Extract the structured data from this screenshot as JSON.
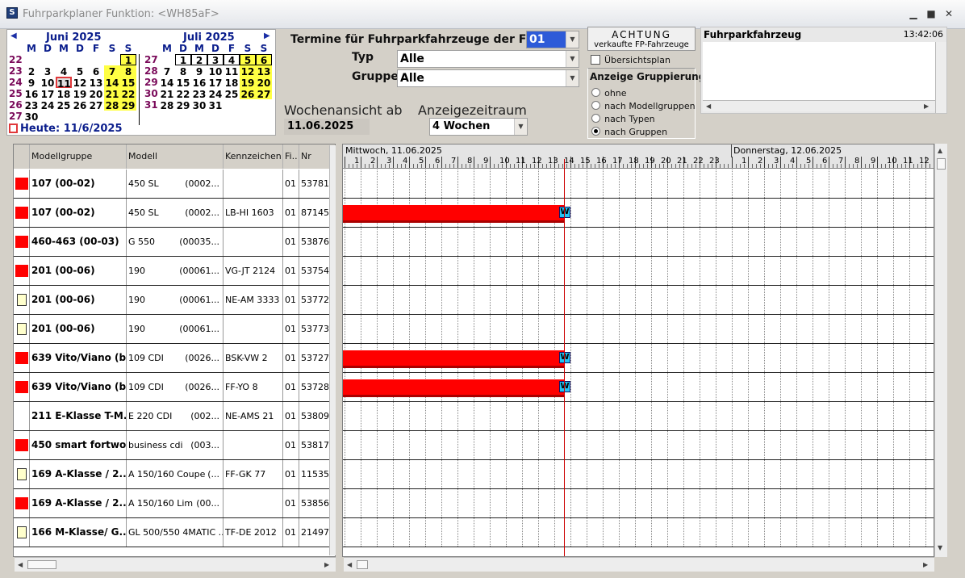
{
  "window": {
    "title": "Fuhrparkplaner Funktion: <WH85aF>",
    "min": "▁",
    "max": "■",
    "close": "✕"
  },
  "calendar": {
    "month1": "Juni 2025",
    "month2": "Juli 2025",
    "dow": [
      "M",
      "D",
      "M",
      "D",
      "F",
      "S",
      "S"
    ],
    "weeks1": [
      "22",
      "23",
      "24",
      "25",
      "26",
      "27"
    ],
    "weeks2": [
      "27",
      "28",
      "29",
      "30",
      "31"
    ],
    "days1": [
      [
        "",
        "",
        "",
        "",
        "",
        "",
        "1"
      ],
      [
        "2",
        "3",
        "4",
        "5",
        "6",
        "7",
        "8"
      ],
      [
        "9",
        "10",
        "11",
        "12",
        "13",
        "14",
        "15"
      ],
      [
        "16",
        "17",
        "18",
        "19",
        "20",
        "21",
        "22"
      ],
      [
        "23",
        "24",
        "25",
        "26",
        "27",
        "28",
        "29"
      ],
      [
        "30",
        "",
        "",
        "",
        "",
        "",
        ""
      ]
    ],
    "days2": [
      [
        "",
        "1",
        "2",
        "3",
        "4",
        "5",
        "6"
      ],
      [
        "7",
        "8",
        "9",
        "10",
        "11",
        "12",
        "13"
      ],
      [
        "14",
        "15",
        "16",
        "17",
        "18",
        "19",
        "20"
      ],
      [
        "21",
        "22",
        "23",
        "24",
        "25",
        "26",
        "27"
      ],
      [
        "28",
        "29",
        "30",
        "31",
        "",
        "",
        ""
      ]
    ],
    "today_label": "Heute: 11/6/2025"
  },
  "filters": {
    "filiale_label": "Termine für Fuhrparkfahrzeuge der Filiale",
    "filiale_value": "01",
    "typ_label": "Typ",
    "typ_value": "Alle",
    "gruppe_label": "Gruppe",
    "gruppe_value": "Alle",
    "wochen_label": "Wochenansicht ab",
    "wochen_value": "11.06.2025",
    "zeitraum_label": "Anzeigezeitraum",
    "zeitraum_value": "4 Wochen"
  },
  "achtung": {
    "line1": "ACHTUNG",
    "line2": "verkaufte FP-Fahrzeuge"
  },
  "uebersicht_label": "Übersichtsplan",
  "gruppierung": {
    "title": "Anzeige Gruppierung",
    "options": [
      "ohne",
      "nach Modellgruppen",
      "nach Typen",
      "nach Gruppen"
    ],
    "selected": 3
  },
  "fp_panel": {
    "title": "Fuhrparkfahrzeug",
    "time": "13:42:06"
  },
  "grid": {
    "columns": [
      "Modellgruppe",
      "Modell",
      "Kennzeichen",
      "Fi..",
      "Nr"
    ],
    "rows": [
      {
        "mark": "red",
        "gruppe": "107 (00-02)",
        "modell": "450 SL",
        "code": "(0002...",
        "kz": "",
        "fi": "01",
        "nr": "53781",
        "bar": false
      },
      {
        "mark": "red",
        "gruppe": "107 (00-02)",
        "modell": "450 SL",
        "code": "(0002...",
        "kz": "LB-HI 1603",
        "fi": "01",
        "nr": "87145",
        "bar": true
      },
      {
        "mark": "red",
        "gruppe": "460-463 (00-03)",
        "modell": "G 550",
        "code": "(00035...",
        "kz": "",
        "fi": "01",
        "nr": "53876",
        "bar": false
      },
      {
        "mark": "red",
        "gruppe": "201 (00-06)",
        "modell": "190",
        "code": "(00061...",
        "kz": "VG-JT 2124",
        "fi": "01",
        "nr": "53754",
        "bar": false
      },
      {
        "mark": "note",
        "gruppe": "201 (00-06)",
        "modell": "190",
        "code": "(00061...",
        "kz": "NE-AM 3333",
        "fi": "01",
        "nr": "53772",
        "bar": false
      },
      {
        "mark": "note",
        "gruppe": "201 (00-06)",
        "modell": "190",
        "code": "(00061...",
        "kz": "",
        "fi": "01",
        "nr": "53773",
        "bar": false
      },
      {
        "mark": "red",
        "gruppe": "639 Vito/Viano (b...",
        "modell": "109 CDI",
        "code": "(0026...",
        "kz": "BSK-VW 2",
        "fi": "01",
        "nr": "53727",
        "bar": true
      },
      {
        "mark": "red",
        "gruppe": "639 Vito/Viano (b...",
        "modell": "109 CDI",
        "code": "(0026...",
        "kz": "FF-YO 8",
        "fi": "01",
        "nr": "53728",
        "bar": true
      },
      {
        "mark": "",
        "gruppe": "211 E-Klasse T-M...",
        "modell": "E 220 CDI",
        "code": "(002...",
        "kz": "NE-AMS 21",
        "fi": "01",
        "nr": "53809",
        "bar": false
      },
      {
        "mark": "red",
        "gruppe": "450 smart fortwo ...",
        "modell": "business cdi",
        "code": "(003...",
        "kz": "",
        "fi": "01",
        "nr": "53817",
        "bar": false
      },
      {
        "mark": "note",
        "gruppe": "169 A-Klasse / 2...",
        "modell": "A 150/160 Coupe",
        "code": "(...",
        "kz": "FF-GK 77",
        "fi": "01",
        "nr": "11535",
        "bar": false
      },
      {
        "mark": "red",
        "gruppe": "169 A-Klasse / 2...",
        "modell": "A 150/160 Lim",
        "code": "(00...",
        "kz": "",
        "fi": "01",
        "nr": "53856",
        "bar": false
      },
      {
        "mark": "note",
        "gruppe": "166 M-Klasse/ G...",
        "modell": "GL 500/550 4MATIC ...",
        "code": "",
        "kz": "TF-DE 2012",
        "fi": "01",
        "nr": "21497",
        "bar": false
      }
    ],
    "badge": "W"
  },
  "timeline": {
    "day1": "Mittwoch, 11.06.2025",
    "day2": "Donnerstag, 12.06.2025",
    "hours1": [
      "1",
      "2",
      "3",
      "4",
      "5",
      "6",
      "7",
      "8",
      "9",
      "10",
      "11",
      "12",
      "13",
      "14",
      "15",
      "16",
      "17",
      "18",
      "19",
      "20",
      "21",
      "22",
      "23"
    ],
    "hours2": [
      "1",
      "2",
      "3",
      "4",
      "5",
      "6",
      "7",
      "8",
      "9",
      "10",
      "11",
      "12"
    ]
  }
}
